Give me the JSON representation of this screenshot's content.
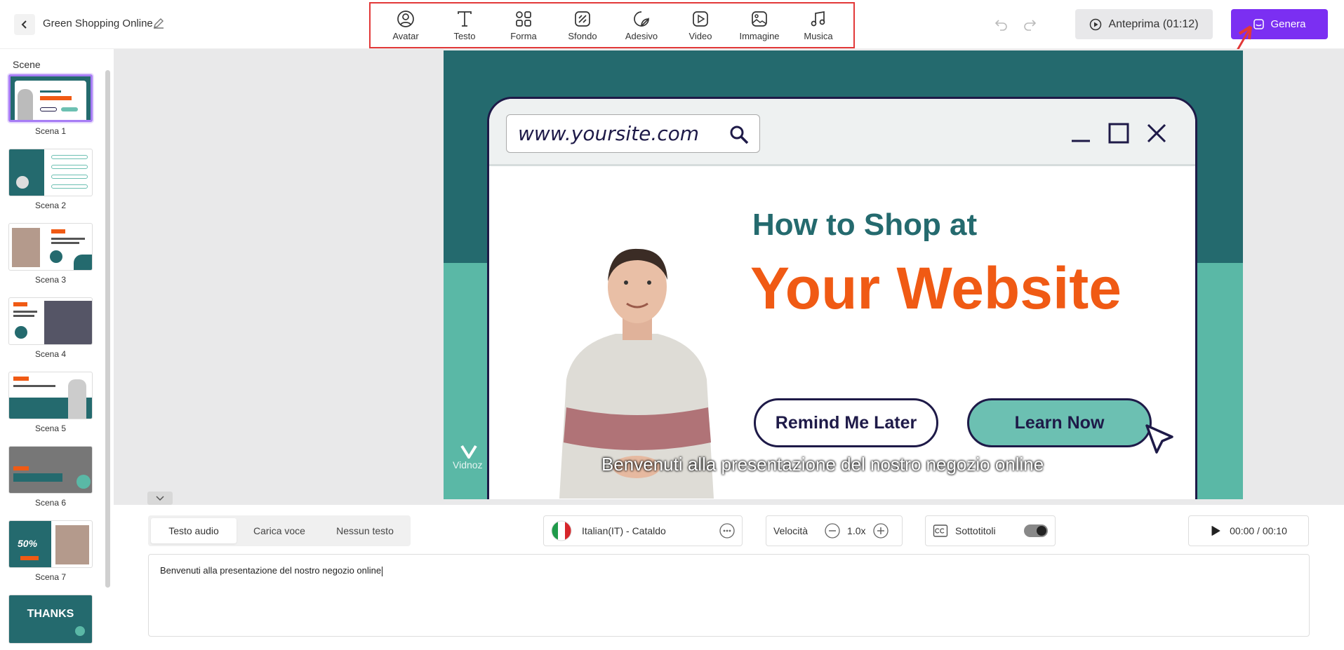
{
  "header": {
    "project_title": "Green Shopping Online",
    "tools": [
      {
        "label": "Avatar",
        "icon": "avatar-icon"
      },
      {
        "label": "Testo",
        "icon": "text-icon"
      },
      {
        "label": "Forma",
        "icon": "shapes-icon"
      },
      {
        "label": "Sfondo",
        "icon": "background-icon"
      },
      {
        "label": "Adesivo",
        "icon": "sticker-icon"
      },
      {
        "label": "Video",
        "icon": "video-icon"
      },
      {
        "label": "Immagine",
        "icon": "image-icon"
      },
      {
        "label": "Musica",
        "icon": "music-icon"
      }
    ],
    "preview_label": "Anteprima (01:12)",
    "generate_label": "Genera"
  },
  "sidebar": {
    "title": "Scene",
    "scenes": [
      {
        "label": "Scena 1"
      },
      {
        "label": "Scena 2"
      },
      {
        "label": "Scena 3"
      },
      {
        "label": "Scena 4"
      },
      {
        "label": "Scena 5"
      },
      {
        "label": "Scena 6"
      },
      {
        "label": "Scena 7"
      },
      {
        "label": "THANKS"
      }
    ]
  },
  "slide": {
    "url": "www.yoursite.com",
    "headline_1": "How to Shop at",
    "headline_2": "Your Website",
    "button_remind": "Remind Me Later",
    "button_learn": "Learn Now",
    "subtitle": "Benvenuti alla presentazione del nostro negozio online",
    "watermark": "Vidnoz"
  },
  "bottom": {
    "tabs": [
      {
        "label": "Testo audio"
      },
      {
        "label": "Carica voce"
      },
      {
        "label": "Nessun testo"
      }
    ],
    "voice": "Italian(IT) - Cataldo",
    "speed_label": "Velocità",
    "speed_value": "1.0x",
    "subtitles_label": "Sottotitoli",
    "time": "00:00 / 00:10",
    "script_text": "Benvenuti alla presentazione del nostro negozio online"
  },
  "colors": {
    "accent": "#7b2ff2",
    "slide_dark": "#246a6e",
    "slide_light": "#5ab8a6",
    "orange": "#f05a14"
  }
}
